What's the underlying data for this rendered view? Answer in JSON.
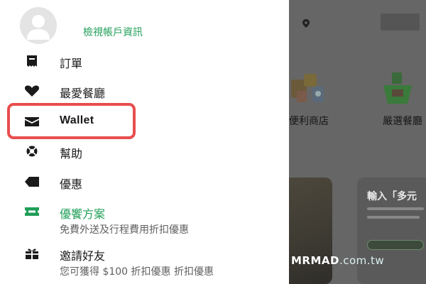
{
  "drawer": {
    "view_account_link": "檢視帳戶資訊",
    "menu": {
      "orders": {
        "label": "訂單",
        "icon": "receipt-icon"
      },
      "favorites": {
        "label": "最愛餐廳",
        "icon": "heart-icon"
      },
      "wallet": {
        "label": "Wallet",
        "icon": "wallet-icon"
      },
      "help": {
        "label": "幫助",
        "icon": "lifebuoy-icon"
      },
      "promotions": {
        "label": "優惠",
        "icon": "tag-icon"
      },
      "plan": {
        "label": "優饗方案",
        "sublabel": "免費外送及行程費用折扣優惠",
        "icon": "ticket-icon"
      },
      "invite": {
        "label": "邀請好友",
        "sublabel": "您可獲得 $100 折扣優惠 折扣優惠",
        "icon": "gift-icon"
      }
    }
  },
  "background": {
    "categories": [
      {
        "label": "便利商店"
      },
      {
        "label": "嚴選餐廳"
      }
    ],
    "promo": {
      "title": "輸入「多元"
    }
  },
  "watermark": {
    "brand": "MRMAD",
    "suffix": ".com.tw"
  },
  "colors": {
    "accent_green": "#1f9e58",
    "highlight_red": "#e84e4e",
    "overlay": "#666666"
  }
}
